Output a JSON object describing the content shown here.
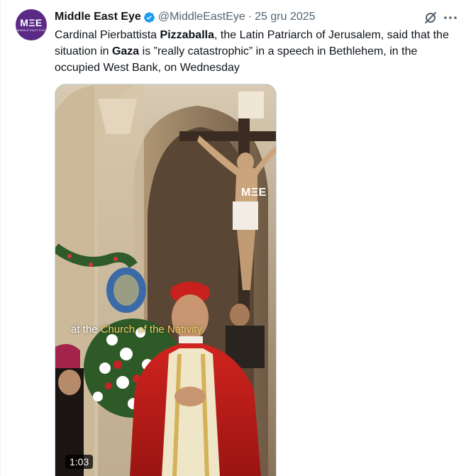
{
  "tweet": {
    "avatar_logo": "MΞE",
    "avatar_sub": "MIDDLE EAST EYE",
    "name": "Middle East Eye",
    "handle": "@MiddleEastEye",
    "separator": "·",
    "date": "25 gru 2025",
    "text_parts": [
      {
        "text": "Cardinal Pierbattista ",
        "bold": false
      },
      {
        "text": "Pizzaballa",
        "bold": true
      },
      {
        "text": ", the Latin Patriarch of Jerusalem, said that the situation in ",
        "bold": false
      },
      {
        "text": "Gaza",
        "bold": true
      },
      {
        "text": " is ”really catastrophic” in a speech in Bethlehem, in the occupied West Bank, on Wednesday",
        "bold": false
      }
    ]
  },
  "media": {
    "watermark": "MΞE",
    "caption_plain": "at the ",
    "caption_highlight": "Church of the Nativity.",
    "duration": "1:03"
  },
  "colors": {
    "verified": "#1d9bf0",
    "avatar_bg": "#5b2a86",
    "caption_highlight": "#f0d060"
  },
  "icons": [
    "verified-badge-icon",
    "grok-icon",
    "more-icon"
  ]
}
